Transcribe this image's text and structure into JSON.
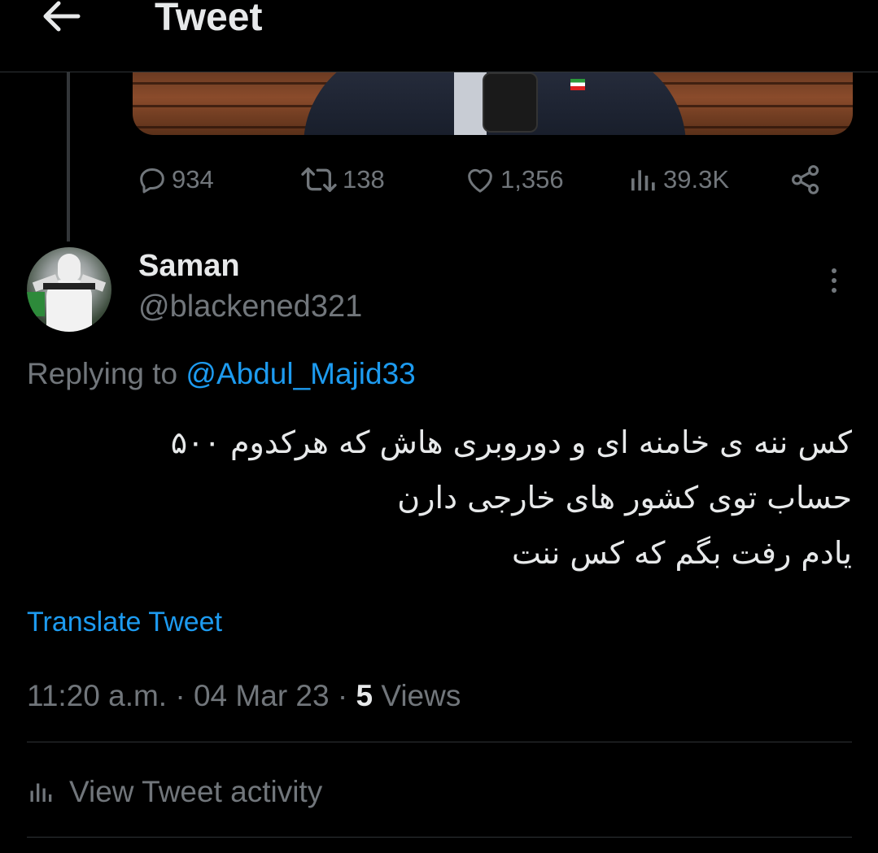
{
  "header": {
    "title": "Tweet",
    "back_icon": "arrow-left-icon"
  },
  "parent_tweet": {
    "stats": {
      "replies": "934",
      "retweets": "138",
      "likes": "1,356",
      "views": "39.3K"
    }
  },
  "reply": {
    "author": {
      "display_name": "Saman",
      "handle": "@blackened321"
    },
    "replying_prefix": "Replying to",
    "replying_to": "@Abdul_Majid33",
    "text_lines": [
      "کس ننه ی خامنه ای و دوروبری هاش که هرکدوم ۵۰۰",
      "حساب توی کشور های خارجی دارن",
      "یادم رفت بگم که کس ننت"
    ],
    "translate_label": "Translate Tweet",
    "time": "11:20 a.m.",
    "date": "04 Mar 23",
    "separator": "·",
    "views_count": "5",
    "views_label": "Views",
    "activity_label": "View Tweet activity"
  },
  "colors": {
    "background": "#000000",
    "text": "#e7e9ea",
    "muted": "#71767b",
    "link": "#1d9bf0",
    "divider": "#2f3336"
  }
}
